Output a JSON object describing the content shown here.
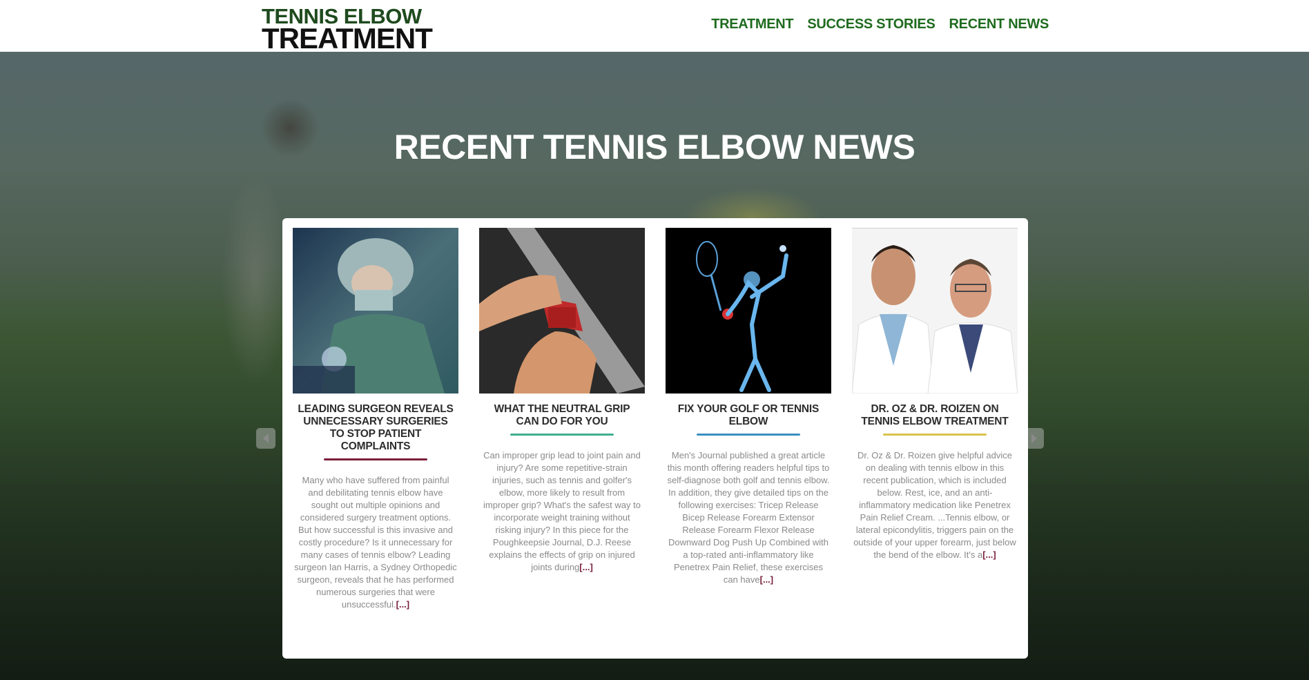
{
  "header": {
    "logo_line1": "TENNIS ELBOW",
    "logo_line2": "TREATMENT",
    "nav": [
      "TREATMENT",
      "SUCCESS STORIES",
      "RECENT NEWS"
    ]
  },
  "hero": {
    "title": "RECENT TENNIS ELBOW NEWS"
  },
  "articles": [
    {
      "image": "surgeon-photo",
      "title": "LEADING SURGEON REVEALS UNNECESSARY SURGERIES TO STOP PATIENT COMPLAINTS",
      "rule_color": "#7a1f3a",
      "excerpt": "Many who have suffered from painful and debilitating tennis elbow have sought out multiple opinions and considered surgery treatment options. But how successful is this invasive and costly procedure? Is it unnecessary for many cases of tennis elbow? Leading surgeon Ian Harris, a Sydney Orthopedic surgeon, reveals that he has performed numerous surgeries that were unsuccessful.",
      "more": "[...]"
    },
    {
      "image": "grip-photo",
      "title": "WHAT THE NEUTRAL GRIP CAN DO FOR YOU",
      "rule_color": "#3fae8f",
      "excerpt": "Can improper grip lead to joint pain and injury? Are some repetitive-strain injuries, such as tennis and golfer's elbow, more likely to result from improper grip? What's the safest way to incorporate weight training without risking injury? In this piece for the Poughkeepsie Journal, D.J. Reese explains the effects of grip on injured joints during",
      "more": "[...]"
    },
    {
      "image": "skeleton-photo",
      "title": "FIX YOUR GOLF OR TENNIS ELBOW",
      "rule_color": "#3a8fc0",
      "excerpt": "Men's Journal published a great article this month offering readers helpful tips to self-diagnose both golf and tennis elbow. In addition, they give detailed tips on the following exercises: Tricep Release Bicep Release Forearm Extensor Release Forearm Flexor Release Downward Dog Push Up Combined with a top-rated anti-inflammatory like Penetrex Pain Relief, these exercises can have",
      "more": "[...]"
    },
    {
      "image": "doctors-photo",
      "title": "DR. OZ & DR. ROIZEN ON TENNIS ELBOW TREATMENT",
      "rule_color": "#d8c24a",
      "excerpt": "Dr. Oz & Dr. Roizen give helpful advice on dealing with tennis elbow in this recent publication, which is included below. Rest, ice, and an anti-inflammatory medication like Penetrex Pain Relief Cream. ...Tennis elbow, or lateral epicondylitis, triggers pain on the outside of your upper forearm, just below the bend of the elbow. It's a",
      "more": "[...]"
    }
  ],
  "carousel": {
    "prev_icon": "chevron-left-icon",
    "next_icon": "chevron-right-icon"
  }
}
